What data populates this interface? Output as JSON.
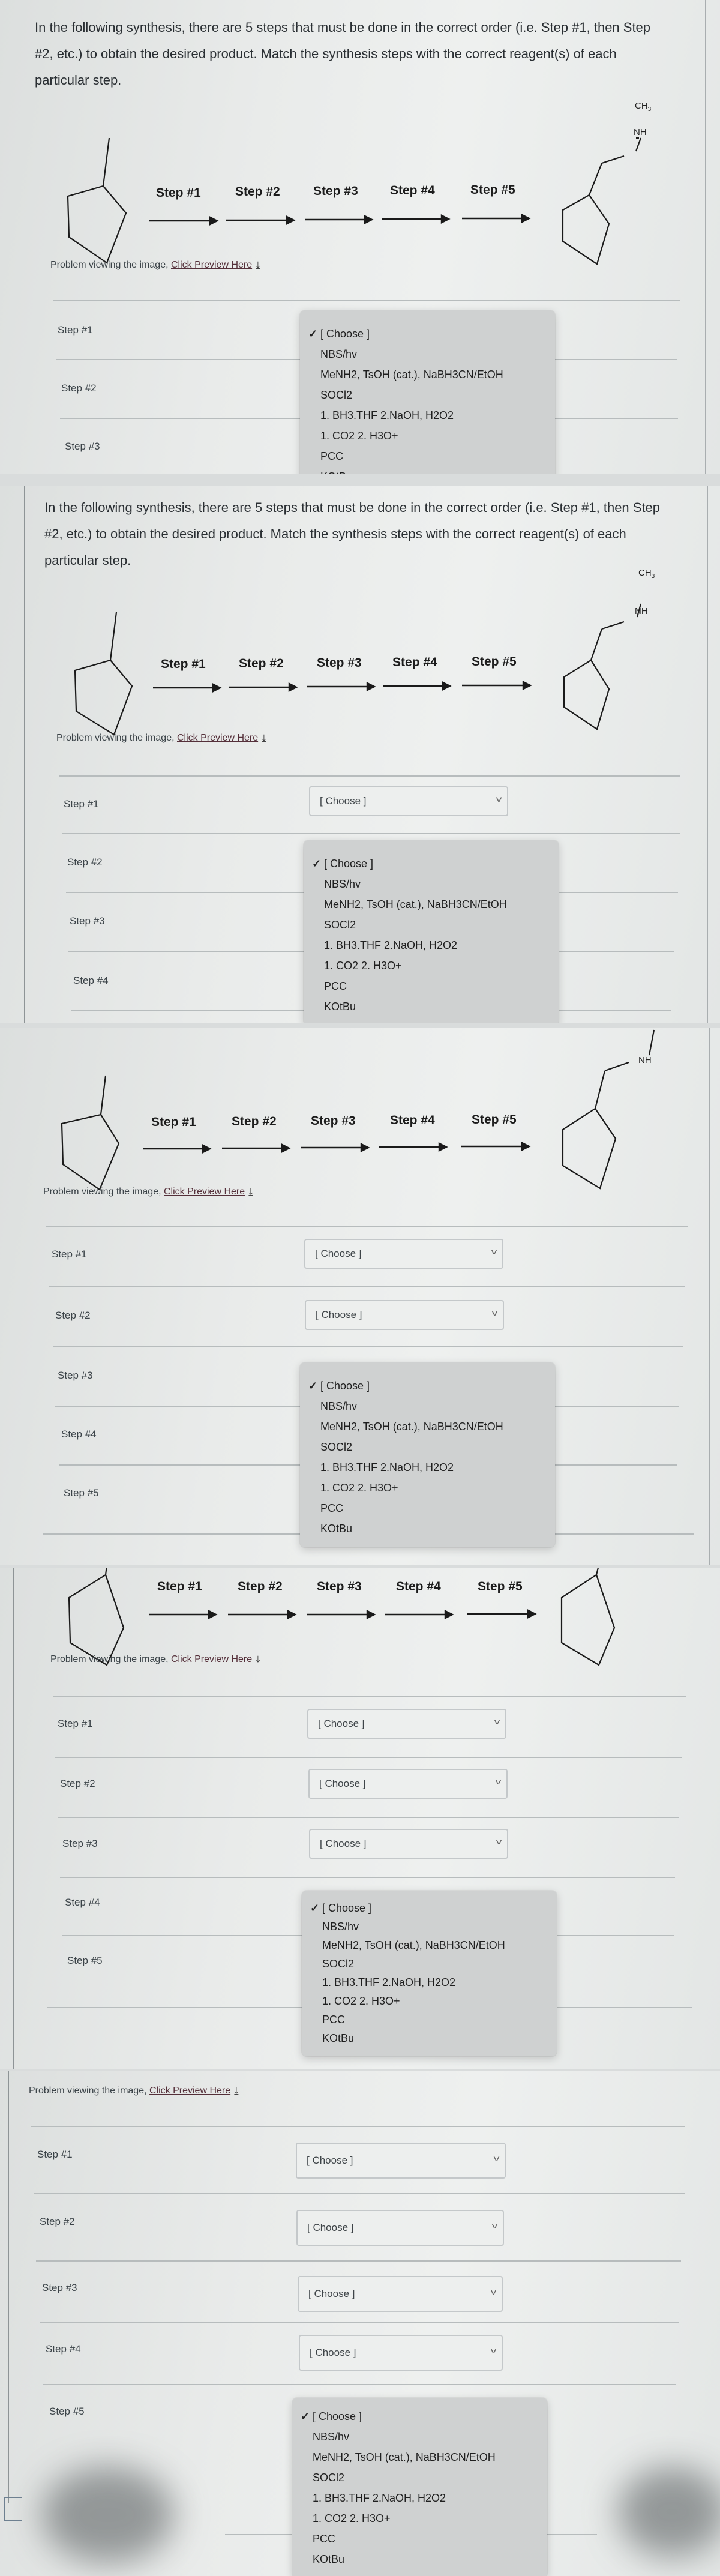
{
  "question": {
    "text": "In the following synthesis, there are 5 steps that must be done in the correct order (i.e. Step #1, then Step #2, etc.) to obtain the desired product. Match the synthesis steps with the correct reagent(s) of each particular step."
  },
  "scheme": {
    "steps": [
      "Step #1",
      "Step #2",
      "Step #3",
      "Step #4",
      "Step #5"
    ],
    "starting_material": "methylcyclopentane",
    "product": "N-methyl-1-cyclopentylmethanamine",
    "labels": {
      "ch3": "CH",
      "ch3_sub": "3",
      "nh": "NH"
    }
  },
  "preview": {
    "prefix": "Problem viewing the image, ",
    "link": "Click Preview Here",
    "icon": "download-arrow-icon"
  },
  "rows": [
    {
      "label": "Step #1",
      "value": "[ Choose ]"
    },
    {
      "label": "Step #2",
      "value": "[ Choose ]"
    },
    {
      "label": "Step #3",
      "value": "[ Choose ]"
    },
    {
      "label": "Step #4",
      "value": "[ Choose ]"
    },
    {
      "label": "Step #5",
      "value": "[ Choose ]"
    }
  ],
  "dropdown": {
    "selected_mark": "✓",
    "options": [
      "[ Choose ]",
      "NBS/hv",
      "MeNH2, TsOH (cat.), NaBH3CN/EtOH",
      "SOCl2",
      "1. BH3.THF 2.NaOH, H2O2",
      "1. CO2 2. H3O+",
      "PCC",
      "KOtBu"
    ],
    "selected_index": 0
  },
  "captures": [
    {
      "open_step": "Step #1"
    },
    {
      "open_step": "Step #2"
    },
    {
      "open_step": "Step #3"
    },
    {
      "open_step": "Step #4"
    },
    {
      "open_step": "Step #5"
    }
  ]
}
